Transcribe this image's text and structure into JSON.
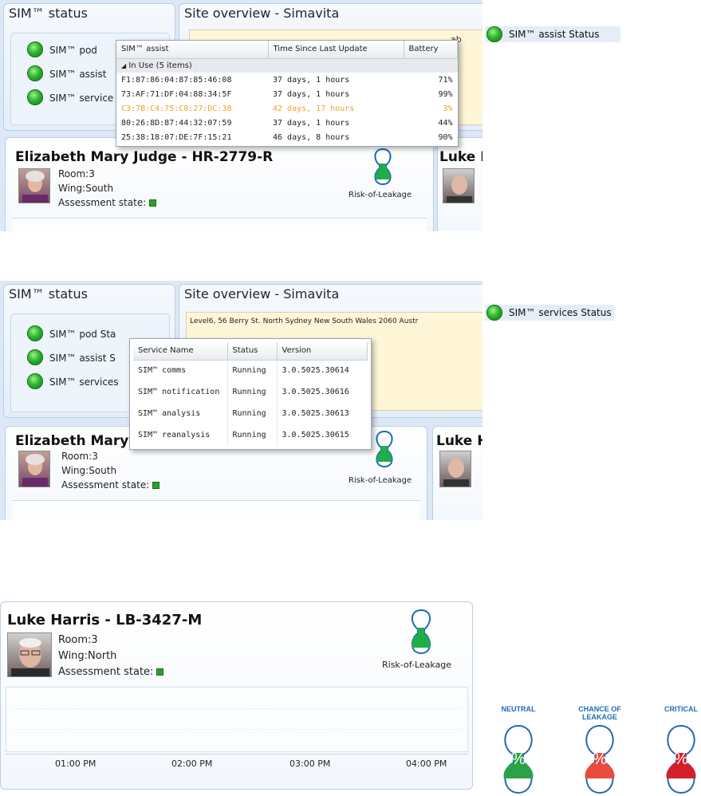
{
  "panel1": {
    "sim_status_title": "SIM™ status",
    "site_overview_title": "Site overview - Simavita",
    "status_items": [
      "SIM™ pod",
      "SIM™ assist",
      "SIM™ services"
    ],
    "overview_fragment": "ab",
    "legend": "SIM™ assist Status",
    "popup": {
      "columns": [
        "SIM™ assist",
        "Time Since Last Update",
        "Battery"
      ],
      "group_label": "In Use (5 items)",
      "rows": [
        {
          "id": "F1:87:86:04:87:85:46:08",
          "time": "37 days, 1 hours",
          "battery": "71%",
          "warn": false
        },
        {
          "id": "73:AF:71:DF:04:88:34:5F",
          "time": "37 days, 1 hours",
          "battery": "99%",
          "warn": false
        },
        {
          "id": "C3:7B:C4:75:C8:27:DC:38",
          "time": "42 days, 17 hours",
          "battery": "3%",
          "warn": true
        },
        {
          "id": "80:26:8D:87:44:32:07:59",
          "time": "37 days, 1 hours",
          "battery": "44%",
          "warn": false
        },
        {
          "id": "25:38:18:07:DE:7F:15:21",
          "time": "46 days, 8 hours",
          "battery": "90%",
          "warn": false
        }
      ]
    },
    "patient": {
      "name": "Elizabeth Mary Judge  -  HR-2779-R",
      "room": "Room:3",
      "wing": "Wing:South",
      "assessment": "Assessment state:",
      "risk": "Risk-of-Leakage"
    },
    "second_patient_name": "Luke H"
  },
  "panel2": {
    "sim_status_title": "SIM™ status",
    "site_overview_title": "Site overview - Simavita",
    "address": "Level6, 56 Berry St. North Sydney New South Wales 2060 Austr",
    "status_items": [
      "SIM™ pod  Sta",
      "SIM™ assist S",
      "SIM™ services"
    ],
    "legend": "SIM™ services Status",
    "popup": {
      "columns": [
        "Service Name",
        "Status",
        "Version"
      ],
      "rows": [
        {
          "name": "SIM™ comms",
          "status": "Running",
          "version": "3.0.5025.30614"
        },
        {
          "name": "SIM™ notification",
          "status": "Running",
          "version": "3.0.5025.30616"
        },
        {
          "name": "SIM™ analysis",
          "status": "Running",
          "version": "3.0.5025.30613"
        },
        {
          "name": "SIM™ reanalysis",
          "status": "Running",
          "version": "3.0.5025.30615"
        }
      ]
    },
    "patient": {
      "name": "Elizabeth Mary .",
      "room": "Room:3",
      "wing": "Wing:South",
      "assessment": "Assessment state:",
      "risk": "Risk-of-Leakage"
    },
    "second_patient_name": "Luke H"
  },
  "panel3": {
    "patient": {
      "name": "Luke Harris  -  LB-3427-M",
      "room": "Room:3",
      "wing": "Wing:North",
      "assessment": "Assessment state:",
      "risk": "Risk-of-Leakage"
    },
    "times": [
      "01:00 PM",
      "02:00 PM",
      "03:00 PM",
      "04:00 PM"
    ]
  },
  "indicators": [
    {
      "label": "NEUTRAL",
      "color": "#2aa24a",
      "symbol": "%"
    },
    {
      "label": "CHANCE OF LEAKAGE",
      "color": "#e94b3c",
      "symbol": "%"
    },
    {
      "label": "CRITICAL",
      "color": "#d4202a",
      "symbol": "%"
    }
  ],
  "colors": {
    "status_green": "#2eb52e",
    "warning_orange": "#f0a020",
    "accent_blue": "#1f6bb5"
  }
}
